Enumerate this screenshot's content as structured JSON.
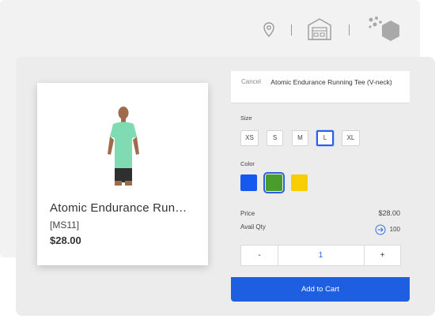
{
  "header": {
    "icons": [
      "location-pin-icon",
      "warehouse-icon",
      "cube-logo-icon"
    ]
  },
  "product": {
    "name": "Atomic Endurance Run…",
    "sku": "[MS11]",
    "price": "$28.00"
  },
  "options": {
    "cancel_label": "Cancel",
    "title": "Atomic Endurance Running Tee (V-neck)",
    "size_label": "Size",
    "sizes": [
      "XS",
      "S",
      "M",
      "L",
      "XL"
    ],
    "selected_size": "L",
    "color_label": "Color",
    "colors": [
      "#1758f0",
      "#4a9d2c",
      "#f7cd03"
    ],
    "selected_color": "#4a9d2c",
    "price_label": "Price",
    "price_value": "$28.00",
    "avail_label": "Avail Qty",
    "avail_value": "100",
    "qty": {
      "minus": "-",
      "value": "1",
      "plus": "+"
    },
    "add_to_cart_label": "Add to Cart"
  }
}
